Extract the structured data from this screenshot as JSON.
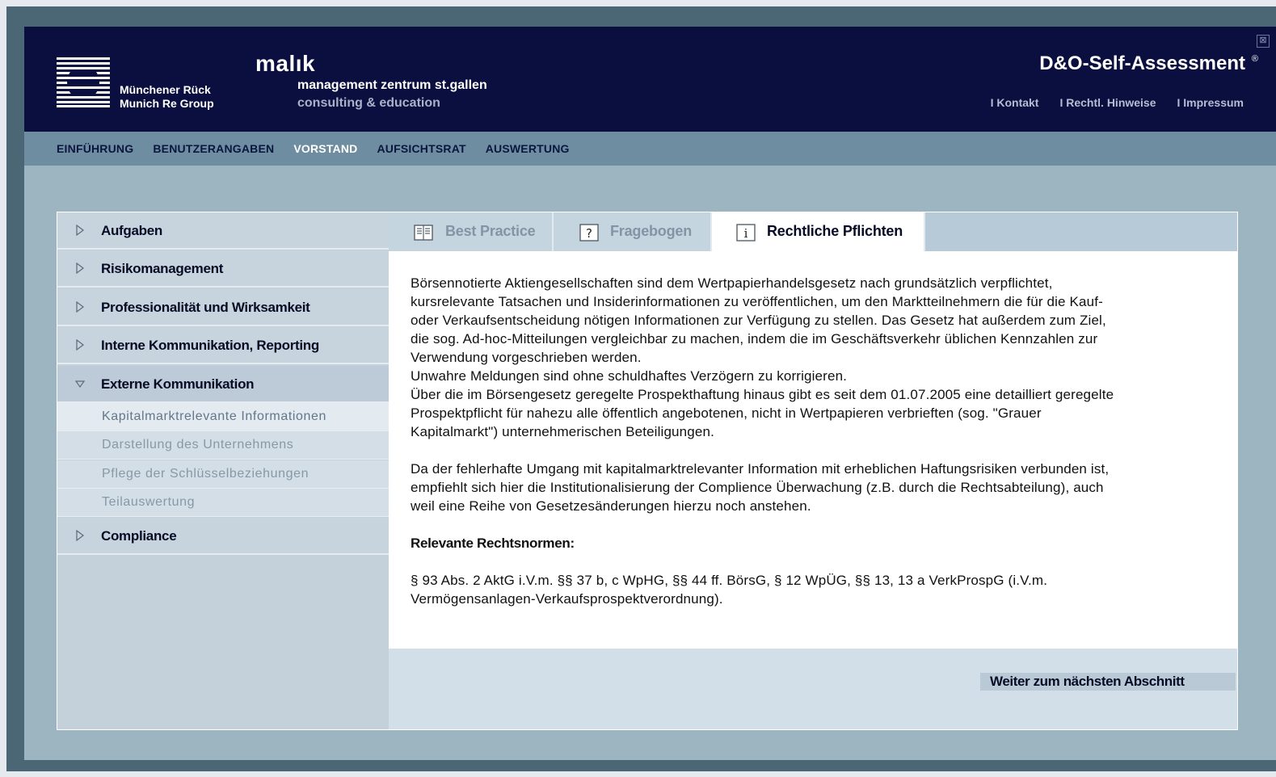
{
  "header": {
    "munich_re_line1": "Münchener Rück",
    "munich_re_line2": "Munich Re Group",
    "malik_wordmark": "malık",
    "malik_line1": "management zentrum st.gallen",
    "malik_line2": "consulting & education",
    "app_title": "D&O-Self-Assessment",
    "reg_mark": "®",
    "close_icon_glyph": "⊠",
    "links": [
      "I Kontakt",
      "I Rechtl. Hinweise",
      "I Impressum"
    ]
  },
  "nav": {
    "items": [
      "EINFÜHRUNG",
      "BENUTZERANGABEN",
      "VORSTAND",
      "AUFSICHTSRAT",
      "AUSWERTUNG"
    ],
    "active": "VORSTAND"
  },
  "sidebar": {
    "sections": [
      {
        "label": "Aufgaben",
        "state": "collapsed"
      },
      {
        "label": "Risikomanagement",
        "state": "collapsed"
      },
      {
        "label": "Professionalität und Wirksamkeit",
        "state": "collapsed"
      },
      {
        "label": "Interne Kommunikation, Reporting",
        "state": "collapsed"
      },
      {
        "label": "Externe Kommunikation",
        "state": "expanded"
      },
      {
        "label": "Compliance",
        "state": "collapsed"
      }
    ],
    "subitems": [
      "Kapitalmarktrelevante Informationen",
      "Darstellung des Unternehmens",
      "Pflege der Schlüsselbeziehungen",
      "Teilauswertung"
    ],
    "current_subitem": "Kapitalmarktrelevante Informationen"
  },
  "tabs": {
    "items": [
      {
        "label": "Best Practice",
        "icon": "document-icon"
      },
      {
        "label": "Fragebogen",
        "icon": "question-icon",
        "glyph": "?"
      },
      {
        "label": "Rechtliche Pflichten",
        "icon": "info-icon",
        "glyph": "i"
      }
    ],
    "active": "Rechtliche Pflichten"
  },
  "content": {
    "lines_p1": [
      "Börsennotierte Aktiengesellschaften sind dem Wertpapierhandelsgesetz nach grundsätzlich verpflichtet,",
      "kursrelevante Tatsachen und Insiderinformationen zu veröffentlichen, um den Marktteilnehmern die für die Kauf-",
      "oder Verkaufsentscheidung nötigen Informationen zur Verfügung zu stellen. Das Gesetz hat außerdem zum Ziel,",
      "die sog. Ad-hoc-Mitteilungen vergleichbar zu machen, indem die im Geschäftsverkehr üblichen Kennzahlen zur",
      "Verwendung vorgeschrieben werden.",
      "Unwahre Meldungen sind ohne schuldhaftes Verzögern zu korrigieren.",
      "Über die im Börsengesetz geregelte Prospekthaftung hinaus gibt es seit dem 01.07.2005 eine detailliert geregelte",
      "Prospektpflicht für nahezu alle öffentlich angebotenen, nicht in Wertpapieren verbrieften (sog. \"Grauer",
      "Kapitalmarkt\") unternehmerischen Beteiligungen."
    ],
    "lines_p2": [
      "Da der fehlerhafte Umgang mit kapitalmarktrelevanter Information mit erheblichen Haftungsrisiken verbunden ist,",
      "empfiehlt sich hier die Institutionalisierung der Complience Überwachung (z.B. durch die Rechtsabteilung), auch",
      "weil eine Reihe von Gesetzesänderungen hierzu noch anstehen."
    ],
    "norms_heading": "Relevante Rechtsnormen:",
    "lines_norms": [
      "§ 93 Abs. 2 AktG i.V.m. §§ 37 b, c WpHG, §§ 44 ff. BörsG, § 12 WpÜG, §§ 13, 13 a VerkProspG (i.V.m.",
      "Vermögensanlagen-Verkaufsprospektverordnung)."
    ]
  },
  "footer": {
    "next_label": "Weiter zum nächsten Abschnitt"
  }
}
